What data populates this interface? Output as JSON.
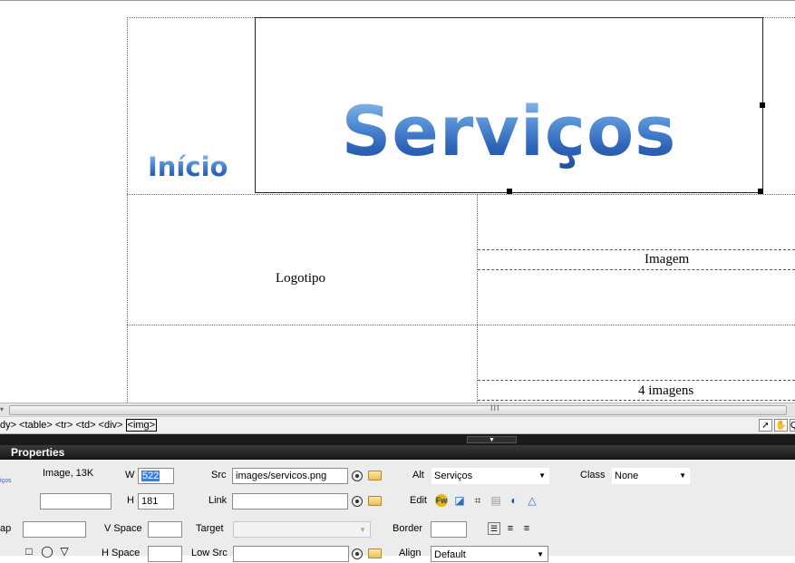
{
  "canvas": {
    "heading_small": "Início",
    "heading_image_alt": "Serviços",
    "cells": {
      "logo": "Logotipo",
      "image": "Imagem",
      "images4": "4 imagens"
    }
  },
  "tagbar": {
    "path_prefix": "dy> <table> <tr> <td> <div>",
    "selected_tag": "<img>",
    "scroll_grip": "III"
  },
  "properties": {
    "title": "Properties",
    "element_info": "Image, 13K",
    "element_id_stub": "iços",
    "w_label": "W",
    "w_value": "522",
    "h_label": "H",
    "h_value": "181",
    "src_label": "Src",
    "src_value": "images/servicos.png",
    "link_label": "Link",
    "link_value": "",
    "alt_label": "Alt",
    "alt_value": "Serviços",
    "class_label": "Class",
    "class_value": "None",
    "edit_label": "Edit",
    "map_label": "ap",
    "vspace_label": "V Space",
    "hspace_label": "H Space",
    "target_label": "Target",
    "lowsrc_label": "Low Src",
    "border_label": "Border",
    "align_label": "Align",
    "align_value": "Default"
  }
}
